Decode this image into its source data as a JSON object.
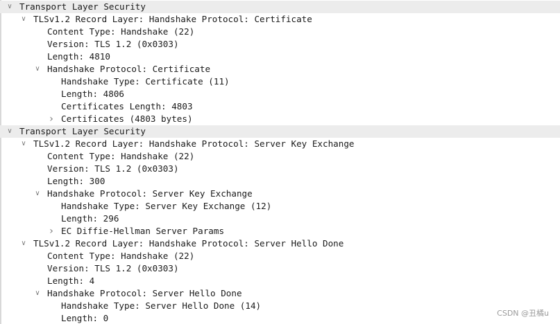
{
  "colors": {
    "header_row_bg": "#ececec",
    "text": "#1a1a1a",
    "arrow": "#7a7a7a",
    "watermark": "#9a9a9a"
  },
  "icons": {
    "expanded": "chevron-down-icon",
    "collapsed": "chevron-right-icon"
  },
  "rows": [
    {
      "label": "Transport Layer Security",
      "depth": 0,
      "state": "expanded",
      "header": true
    },
    {
      "label": "TLSv1.2 Record Layer: Handshake Protocol: Certificate",
      "depth": 1,
      "state": "expanded"
    },
    {
      "label": "Content Type: Handshake (22)",
      "depth": 2,
      "state": "leaf"
    },
    {
      "label": "Version: TLS 1.2 (0x0303)",
      "depth": 2,
      "state": "leaf"
    },
    {
      "label": "Length: 4810",
      "depth": 2,
      "state": "leaf"
    },
    {
      "label": "Handshake Protocol: Certificate",
      "depth": 2,
      "state": "expanded"
    },
    {
      "label": "Handshake Type: Certificate (11)",
      "depth": 3,
      "state": "leaf"
    },
    {
      "label": "Length: 4806",
      "depth": 3,
      "state": "leaf"
    },
    {
      "label": "Certificates Length: 4803",
      "depth": 3,
      "state": "leaf"
    },
    {
      "label": "Certificates (4803 bytes)",
      "depth": 3,
      "state": "collapsed"
    },
    {
      "label": "Transport Layer Security",
      "depth": 0,
      "state": "expanded",
      "header": true
    },
    {
      "label": "TLSv1.2 Record Layer: Handshake Protocol: Server Key Exchange",
      "depth": 1,
      "state": "expanded"
    },
    {
      "label": "Content Type: Handshake (22)",
      "depth": 2,
      "state": "leaf"
    },
    {
      "label": "Version: TLS 1.2 (0x0303)",
      "depth": 2,
      "state": "leaf"
    },
    {
      "label": "Length: 300",
      "depth": 2,
      "state": "leaf"
    },
    {
      "label": "Handshake Protocol: Server Key Exchange",
      "depth": 2,
      "state": "expanded"
    },
    {
      "label": "Handshake Type: Server Key Exchange (12)",
      "depth": 3,
      "state": "leaf"
    },
    {
      "label": "Length: 296",
      "depth": 3,
      "state": "leaf"
    },
    {
      "label": "EC Diffie-Hellman Server Params",
      "depth": 3,
      "state": "collapsed"
    },
    {
      "label": "TLSv1.2 Record Layer: Handshake Protocol: Server Hello Done",
      "depth": 1,
      "state": "expanded"
    },
    {
      "label": "Content Type: Handshake (22)",
      "depth": 2,
      "state": "leaf"
    },
    {
      "label": "Version: TLS 1.2 (0x0303)",
      "depth": 2,
      "state": "leaf"
    },
    {
      "label": "Length: 4",
      "depth": 2,
      "state": "leaf"
    },
    {
      "label": "Handshake Protocol: Server Hello Done",
      "depth": 2,
      "state": "expanded"
    },
    {
      "label": "Handshake Type: Server Hello Done (14)",
      "depth": 3,
      "state": "leaf"
    },
    {
      "label": "Length: 0",
      "depth": 3,
      "state": "leaf"
    }
  ],
  "watermark": "CSDN @丑橘u"
}
